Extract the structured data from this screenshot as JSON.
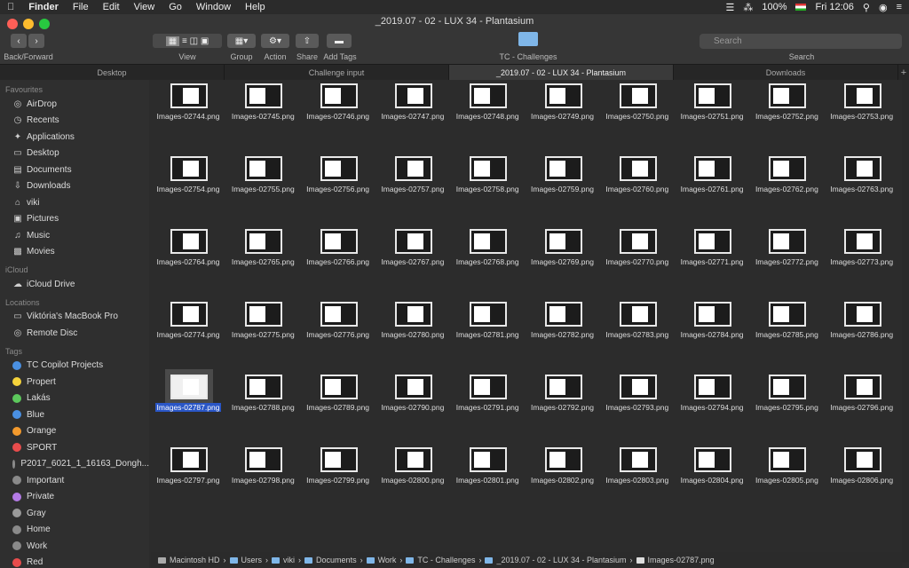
{
  "menubar": {
    "app": "Finder",
    "items": [
      "File",
      "Edit",
      "View",
      "Go",
      "Window",
      "Help"
    ],
    "battery": "100%",
    "time": "Fri 12:06"
  },
  "window": {
    "title": "_2019.07 - 02 - LUX 34 - Plantasium"
  },
  "toolbar": {
    "back_forward": "Back/Forward",
    "view": "View",
    "group": "Group",
    "action": "Action",
    "share": "Share",
    "add_tags": "Add Tags",
    "folder": "TC - Challenges",
    "search_placeholder": "Search",
    "search_label": "Search"
  },
  "tabs": [
    "Desktop",
    "Challenge input",
    "_2019.07 - 02 - LUX 34 - Plantasium",
    "Downloads"
  ],
  "sidebar": {
    "favourites_header": "Favourites",
    "favourites": [
      {
        "label": "AirDrop",
        "icon": "airdrop-icon"
      },
      {
        "label": "Recents",
        "icon": "clock-icon"
      },
      {
        "label": "Applications",
        "icon": "applications-icon"
      },
      {
        "label": "Desktop",
        "icon": "desktop-icon"
      },
      {
        "label": "Documents",
        "icon": "documents-icon"
      },
      {
        "label": "Downloads",
        "icon": "downloads-icon"
      },
      {
        "label": "viki",
        "icon": "home-icon"
      },
      {
        "label": "Pictures",
        "icon": "pictures-icon"
      },
      {
        "label": "Music",
        "icon": "music-icon"
      },
      {
        "label": "Movies",
        "icon": "movies-icon"
      }
    ],
    "icloud_header": "iCloud",
    "icloud": [
      {
        "label": "iCloud Drive",
        "icon": "cloud-icon"
      }
    ],
    "locations_header": "Locations",
    "locations": [
      {
        "label": "Viktória's MacBook Pro",
        "icon": "laptop-icon"
      },
      {
        "label": "Remote Disc",
        "icon": "disc-icon"
      }
    ],
    "tags_header": "Tags",
    "tags": [
      {
        "label": "TC Copilot Projects",
        "color": "#4a90e2"
      },
      {
        "label": "Propert",
        "color": "#f5d33b"
      },
      {
        "label": "Lakás",
        "color": "#5cc85c"
      },
      {
        "label": "Blue",
        "color": "#4a90e2"
      },
      {
        "label": "Orange",
        "color": "#f39a2d"
      },
      {
        "label": "SPORT",
        "color": "#e84c4c"
      },
      {
        "label": "P2017_6021_1_16163_Dongh...",
        "color": "#8a8a8a"
      },
      {
        "label": "Important",
        "color": "#8a8a8a"
      },
      {
        "label": "Private",
        "color": "#b47be6"
      },
      {
        "label": "Gray",
        "color": "#9a9a9a"
      },
      {
        "label": "Home",
        "color": "#8a8a8a"
      },
      {
        "label": "Work",
        "color": "#8a8a8a"
      },
      {
        "label": "Red",
        "color": "#e84c4c"
      }
    ]
  },
  "files": [
    [
      "Images-02744.png",
      "Images-02745.png",
      "Images-02746.png",
      "Images-02747.png",
      "Images-02748.png",
      "Images-02749.png",
      "Images-02750.png",
      "Images-02751.png",
      "Images-02752.png",
      "Images-02753.png"
    ],
    [
      "Images-02754.png",
      "Images-02755.png",
      "Images-02756.png",
      "Images-02757.png",
      "Images-02758.png",
      "Images-02759.png",
      "Images-02760.png",
      "Images-02761.png",
      "Images-02762.png",
      "Images-02763.png"
    ],
    [
      "Images-02764.png",
      "Images-02765.png",
      "Images-02766.png",
      "Images-02767.png",
      "Images-02768.png",
      "Images-02769.png",
      "Images-02770.png",
      "Images-02771.png",
      "Images-02772.png",
      "Images-02773.png"
    ],
    [
      "Images-02774.png",
      "Images-02775.png",
      "Images-02776.png",
      "Images-02780.png",
      "Images-02781.png",
      "Images-02782.png",
      "Images-02783.png",
      "Images-02784.png",
      "Images-02785.png",
      "Images-02786.png"
    ],
    [
      "Images-02787.png",
      "Images-02788.png",
      "Images-02789.png",
      "Images-02790.png",
      "Images-02791.png",
      "Images-02792.png",
      "Images-02793.png",
      "Images-02794.png",
      "Images-02795.png",
      "Images-02796.png"
    ],
    [
      "Images-02797.png",
      "Images-02798.png",
      "Images-02799.png",
      "Images-02800.png",
      "Images-02801.png",
      "Images-02802.png",
      "Images-02803.png",
      "Images-02804.png",
      "Images-02805.png",
      "Images-02806.png"
    ]
  ],
  "selected_file": "Images-02787.png",
  "pathbar": [
    "Macintosh HD",
    "Users",
    "viki",
    "Documents",
    "Work",
    "TC - Challenges",
    "_2019.07 - 02 - LUX 34 - Plantasium",
    "Images-02787.png"
  ]
}
